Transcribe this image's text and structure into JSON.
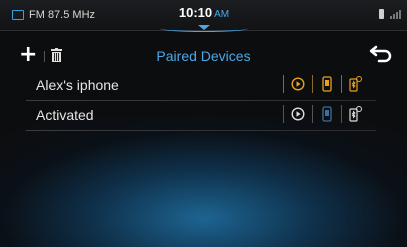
{
  "status_bar": {
    "radio": "FM 87.5 MHz",
    "time": "10:10",
    "ampm": "AM"
  },
  "toolbar": {
    "title": "Paired Devices"
  },
  "devices": [
    {
      "name": "Alex's iphone"
    },
    {
      "name": "Activated"
    }
  ],
  "colors": {
    "accent": "#4aa8e8",
    "orange": "#e8a020"
  },
  "icons": {
    "add": "plus-icon",
    "delete": "trash-icon",
    "back": "back-icon",
    "media": "media-icon",
    "phone": "phone-icon",
    "bluetooth": "bluetooth-settings-icon"
  }
}
